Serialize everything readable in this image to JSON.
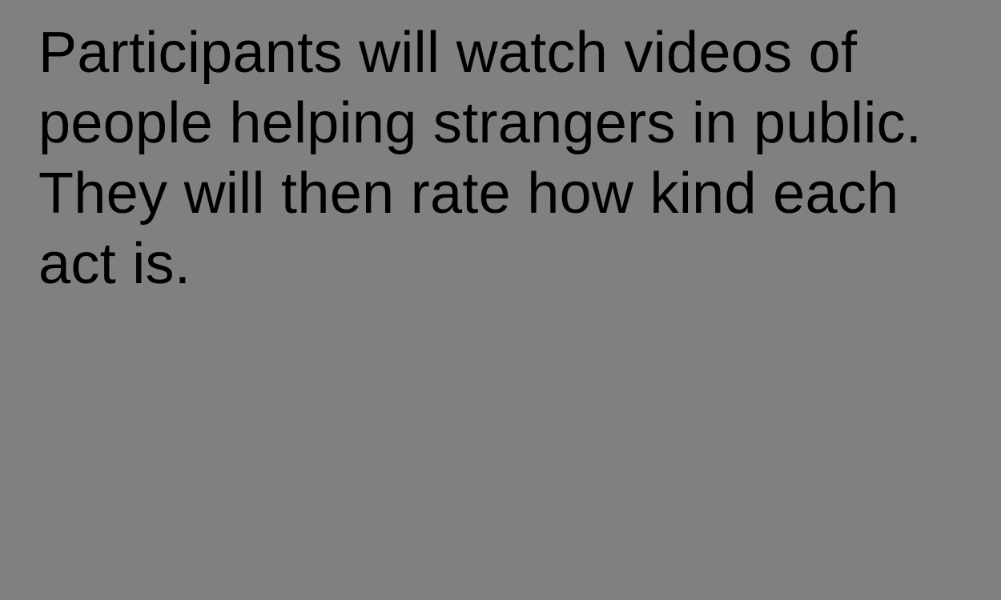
{
  "screen": {
    "background_color": "#808080",
    "text_color": "#000000",
    "instruction_text": "Participants will watch videos of people helping strangers in public. They will then rate how kind each act is."
  }
}
